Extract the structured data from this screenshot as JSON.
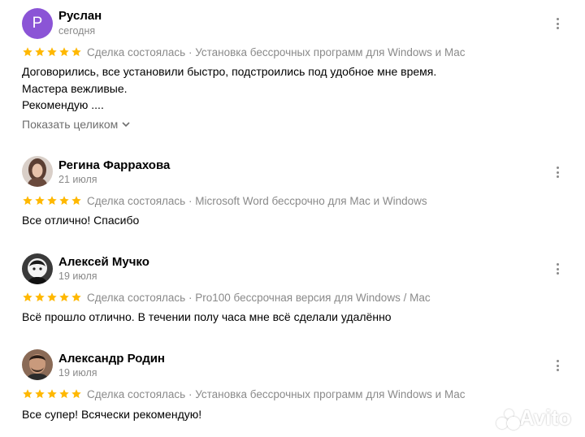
{
  "colors": {
    "star": "#ffb800",
    "avatar_bg": "#8b54d6",
    "muted": "#8a8a8a"
  },
  "reviews": [
    {
      "name": "Руслан",
      "avatar_letter": "Р",
      "date": "сегодня",
      "rating": 5,
      "deal": "Сделка состоялась · Установка бессрочных программ для Windows и Mac",
      "text_lines": [
        "Договорились, все установили быстро, подстроились под удобное мне время.",
        "Мастера вежливые.",
        "Рекомендую ...."
      ],
      "show_more": "Показать целиком"
    },
    {
      "name": "Регина Фаррахова",
      "date": "21 июля",
      "rating": 5,
      "deal": "Сделка состоялась · Microsoft Word бессрочно для Mac и Windows",
      "text_lines": [
        "Все отлично! Спасибо"
      ]
    },
    {
      "name": "Алексей Мучко",
      "date": "19 июля",
      "rating": 5,
      "deal": "Сделка состоялась · Pro100 бессрочная версия для Windows / Mac",
      "text_lines": [
        "Всё прошло отлично. В течении полу часа мне всё сделали удалённо"
      ]
    },
    {
      "name": "Александр Родин",
      "date": "19 июля",
      "rating": 5,
      "deal": "Сделка состоялась · Установка бессрочных программ для Windows и Mac",
      "text_lines": [
        "Все супер! Всячески рекомендую!"
      ]
    }
  ],
  "watermark": "Avito"
}
